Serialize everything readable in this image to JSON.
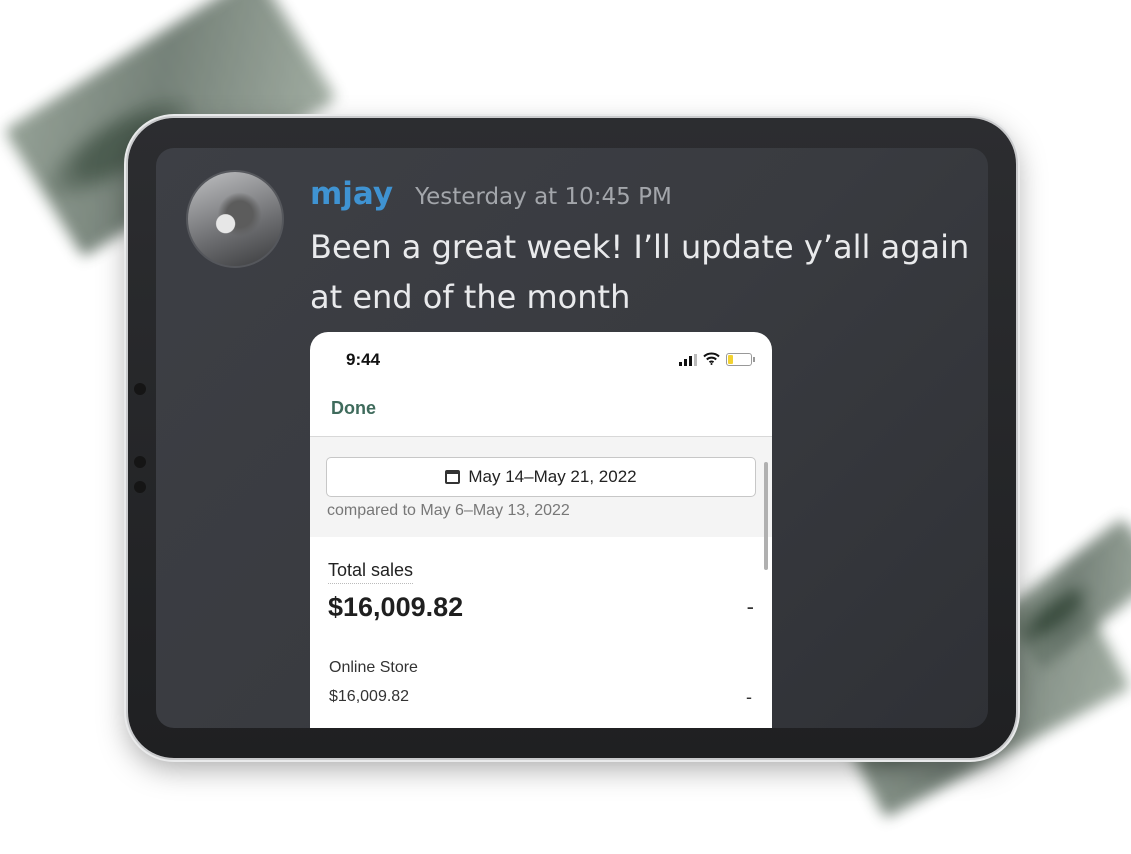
{
  "message": {
    "username": "mjay",
    "timestamp": "Yesterday at 10:45 PM",
    "text": "Been a great week! I’ll update y’all again at end of the month"
  },
  "attachment": {
    "status_time": "9:44",
    "done_label": "Done",
    "date_range": "May 14–May 21, 2022",
    "compared_to": "compared to May 6–May 13, 2022",
    "total_sales_label": "Total sales",
    "total_sales_value": "$16,009.82",
    "total_sales_change": "-",
    "online_store_label": "Online Store",
    "online_store_value": "$16,009.82",
    "online_store_change": "-"
  },
  "icons": [
    "avatar",
    "signal-icon",
    "wifi-icon",
    "battery-icon",
    "calendar-icon"
  ],
  "colors": {
    "username": "#3f93d2",
    "done": "#3f6b5c",
    "battery": "#f2d232"
  }
}
